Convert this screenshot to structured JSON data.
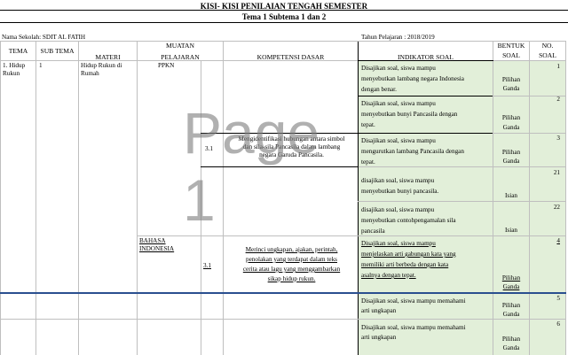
{
  "document": {
    "title_line1": "KISI- KISI PENILAIAN TENGAH SEMESTER",
    "title_line2": "Tema 1 Subtema 1 dan 2",
    "school_label": "Nama Sekolah: SDIT AL FATIH",
    "year_label": "Tahun Pelajaran : 2018/2019",
    "watermark": "Page 1"
  },
  "columns": {
    "tema": "TEMA",
    "subtema": "SUB TEMA",
    "materi": "MATERI",
    "muatan_1": "MUATAN",
    "muatan_2": "PELAJARAN",
    "kd": "KOMPETENSI DASAR",
    "indikator": "INDIKATOR SOAL",
    "bentuk_1": "BENTUK",
    "bentuk_2": "SOAL",
    "no_1": "NO.",
    "no_2": "SOAL"
  },
  "body": {
    "tema": [
      "1. Hidup",
      "Rukun"
    ],
    "subtema": "1",
    "materi": [
      "Hidup Rukun di",
      "Rumah"
    ],
    "mapel_1": "PPKN",
    "mapel_2": [
      "BAHASA",
      "INDONESIA"
    ],
    "kd_no_1": "3.1",
    "kd_text_1": [
      "Mengidentifikasi hubungan antara simbol",
      "dan sila-sila Pancasila dalam lambang",
      "negara Garuda Pancasila."
    ],
    "kd_no_2": "3.1",
    "kd_text_2": [
      "Merinci ungkapan, ajakan, perintah,",
      "penolakan yang terdapat dalam teks",
      "cerita atau lagu yang menggambarkan",
      "sikap hidup rukun."
    ]
  },
  "rows": [
    {
      "indikator": [
        "Disajikan soal, siswa mampu",
        "menyebutkan lambang negara Indonesia",
        "dengan benar."
      ],
      "bentuk": [
        "Pilihan",
        "Ganda"
      ],
      "no": "1"
    },
    {
      "indikator": [
        "Disajikan soal, siswa mampu",
        "menyebutkan bunyi Pancasila dengan",
        "tepat."
      ],
      "bentuk": [
        "Pilihan",
        "Ganda"
      ],
      "no": "2"
    },
    {
      "indikator": [
        "Disajikan soal, siswa mampu",
        "mengurutkan lambang Pancasila dengan",
        "tepat."
      ],
      "bentuk": [
        "Pilihan",
        "Ganda"
      ],
      "no": "3"
    },
    {
      "indikator": [
        "disajikan soal, siswa mampu",
        "menyebutkan bunyi pancasila."
      ],
      "bentuk": [
        "Isian"
      ],
      "no": "21"
    },
    {
      "indikator": [
        "disajikan soal, siswa mampu",
        "menyebutkan contohpengamalan sila",
        "pancasila"
      ],
      "bentuk": [
        "Isian"
      ],
      "no": "22"
    },
    {
      "indikator": [
        "Disajikan soal, siswa mampu",
        "menjelaskan arti gabungan kata yang",
        "memiliki arti berbeda dengan kata",
        "asalnya dengan tepat."
      ],
      "bentuk": [
        "Pilihan",
        "Ganda"
      ],
      "no": "4"
    },
    {
      "indikator": [
        "Disajikan soal, siswa mampu memahami",
        "arti ungkapan"
      ],
      "bentuk": [
        "Pilihan",
        "Ganda"
      ],
      "no": "5"
    },
    {
      "indikator": [
        "Disajikan soal, siswa mampu memahami",
        "arti ungkapan"
      ],
      "bentuk": [
        "Pilihan",
        "Ganda"
      ],
      "no": "6"
    }
  ]
}
